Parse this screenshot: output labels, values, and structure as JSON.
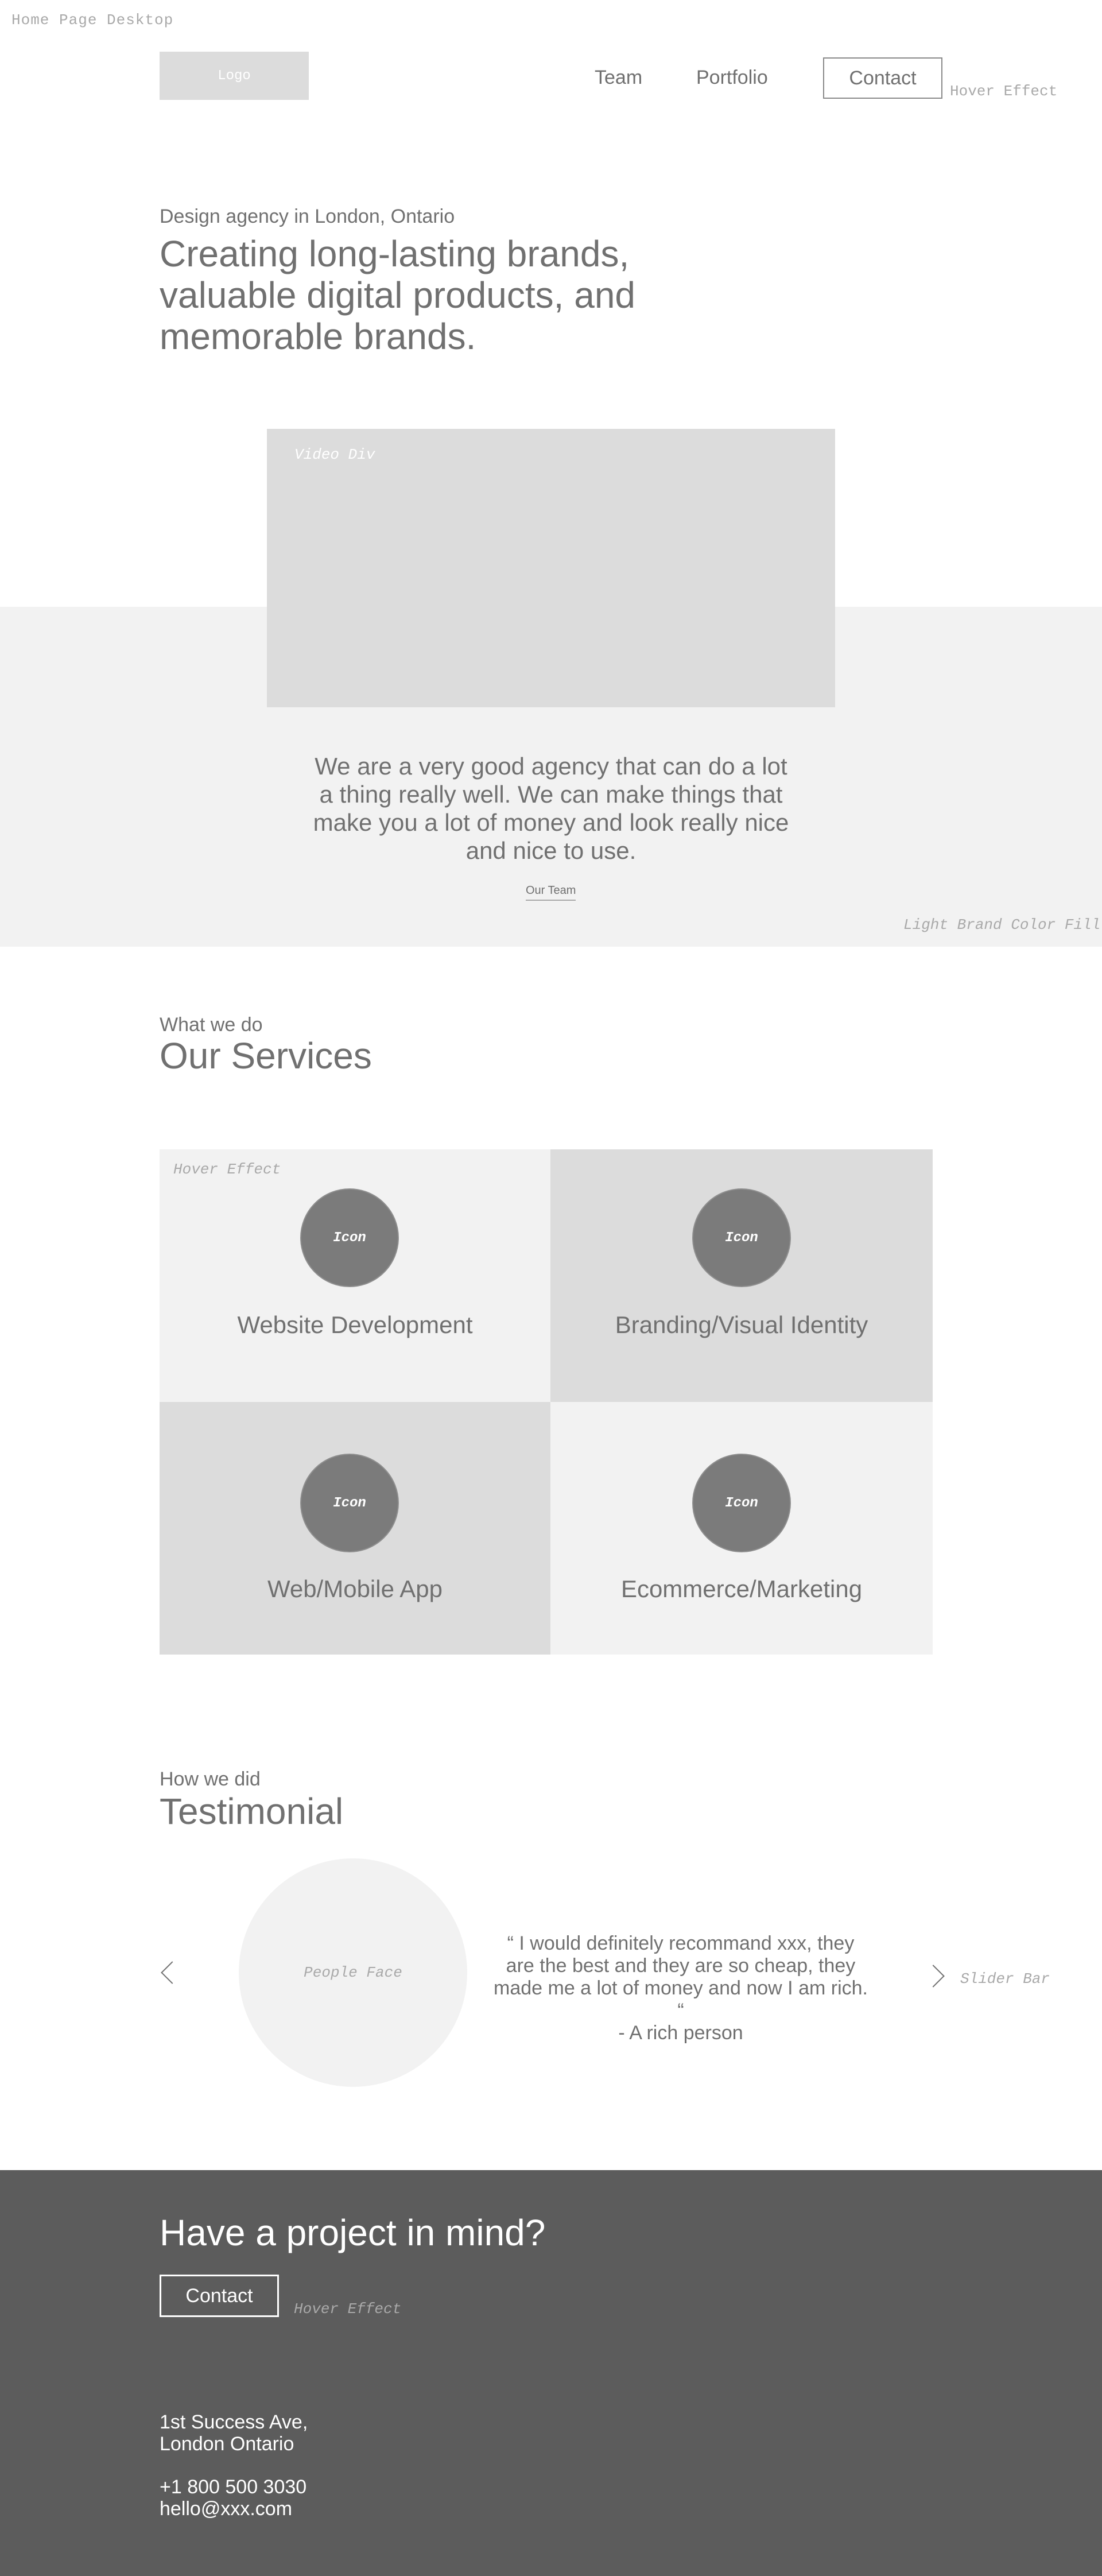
{
  "page_label": "Home Page Desktop",
  "header": {
    "logo_text": "Logo",
    "nav": [
      "Team",
      "Portfolio"
    ],
    "contact_label": "Contact",
    "hover_note": "Hover Effect"
  },
  "hero": {
    "kicker": "Design agency in London, Ontario",
    "title": "Creating long-lasting brands, valuable digital products, and memorable brands."
  },
  "video": {
    "label": "Video Div"
  },
  "about": {
    "text": "We are a very good agency that can do a lot a thing really well. We can make things that make you a lot of money and look really nice and nice to use.",
    "link_label": "Our Team",
    "band_note": "Light Brand Color Fill"
  },
  "services": {
    "kicker": "What we do",
    "title": "Our Services",
    "hover_note": "Hover Effect",
    "icon_label": "Icon",
    "items": [
      {
        "label": "Website Development",
        "shade": "light"
      },
      {
        "label": "Branding/Visual Identity",
        "shade": "dark"
      },
      {
        "label": "Web/Mobile App",
        "shade": "dark"
      },
      {
        "label": "Ecommerce/Marketing",
        "shade": "light"
      }
    ]
  },
  "testimonial": {
    "kicker": "How we did",
    "title": "Testimonial",
    "face_label": "People Face",
    "quote": "“ I would definitely recommand xxx, they are the best and they are so cheap, they made me a lot of money and now I am rich. “",
    "author": "- A rich person",
    "slider_note": "Slider Bar"
  },
  "footer": {
    "cta_title": "Have a project in mind?",
    "contact_label": "Contact",
    "hover_note": "Hover Effect",
    "address_line1": "1st Success Ave,",
    "address_line2": "London Ontario",
    "phone": "+1 800 500 3030",
    "email": "hello@xxx.com"
  },
  "colors": {
    "light_fill": "#f2f2f2",
    "mid_fill": "#dcdcdc",
    "icon_fill": "#7b7b7b",
    "footer_fill": "#5c5c5c",
    "text": "#707070"
  }
}
